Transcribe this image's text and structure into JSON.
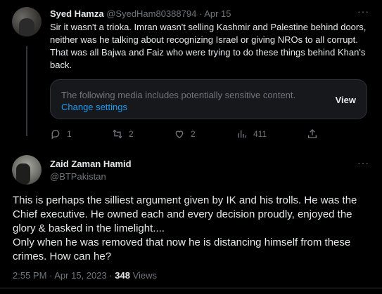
{
  "tweet1": {
    "name": "Syed Hamza",
    "handle": "@SyedHam80388794",
    "separator": "·",
    "date": "Apr 15",
    "text": "Sir it wasn't a trioka. Imran wasn't selling Kashmir and Palestine behind doors, neither was he talking about recognizing Israel or giving NROs to all corrupt. That was all Bajwa and Faiz who were trying to do these things behind Khan's back.",
    "media_warning": {
      "message": "The following media includes potentially sensitive content.",
      "link": "Change settings",
      "view": "View"
    },
    "actions": {
      "replies": "1",
      "retweets": "2",
      "likes": "2",
      "views": "411"
    },
    "more": "···"
  },
  "tweet2": {
    "name": "Zaid Zaman Hamid",
    "handle": "@BTPakistan",
    "more": "···",
    "text_line1": "This is perhaps the silliest argument given by IK and his trolls. He was the Chief executive. He owned each and every decision proudly, enjoyed the glory & basked in the limelight....",
    "text_line2": "Only when he was removed that now he is distancing himself from these crimes. How can he?",
    "time": "2:55 PM · Apr 15, 2023 · ",
    "views_count": "348",
    "views_label": " Views"
  },
  "colors": {
    "background": "#000000",
    "text": "#e7e9ea",
    "muted": "#71767b",
    "link": "#1d9bf0",
    "border": "#2f3336"
  }
}
